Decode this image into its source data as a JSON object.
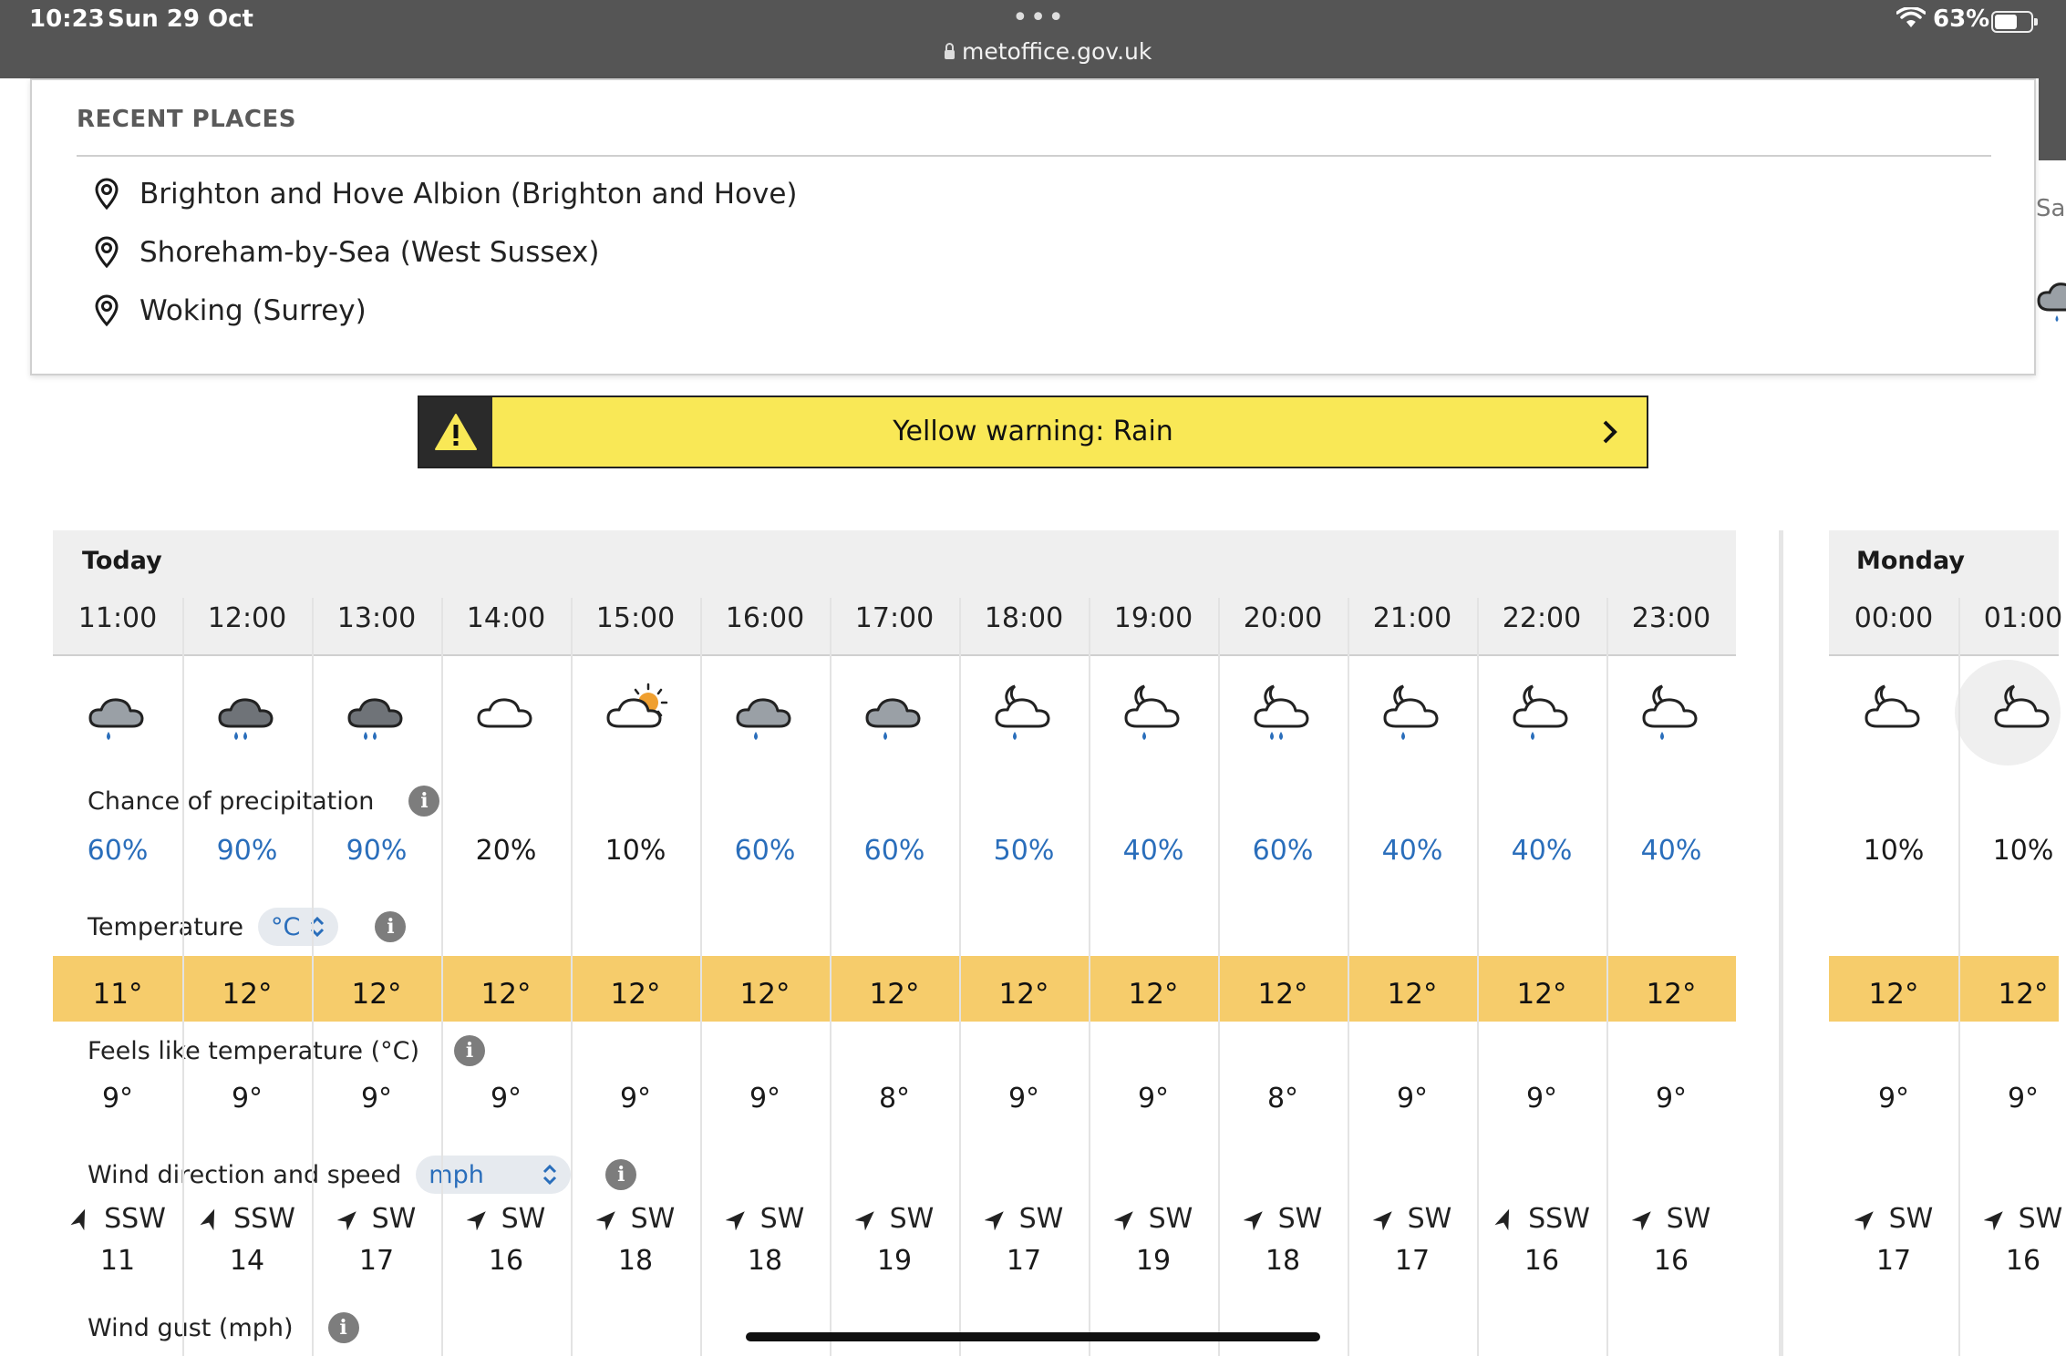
{
  "status_bar": {
    "time": "10:23",
    "date": "Sun 29 Oct",
    "dots": "•••",
    "url": "metoffice.gov.uk",
    "battery": "63%"
  },
  "background": {
    "partial_day": "Sa"
  },
  "recent_places": {
    "title": "RECENT PLACES",
    "items": [
      "Brighton and Hove Albion (Brighton and Hove)",
      "Shoreham-by-Sea (West Sussex)",
      "Woking (Surrey)"
    ]
  },
  "warning": {
    "text": "Yellow warning: Rain",
    "color": "#f9e856"
  },
  "forecast": {
    "days": [
      "Today",
      "Monday"
    ],
    "times": [
      "11:00",
      "12:00",
      "13:00",
      "14:00",
      "15:00",
      "16:00",
      "17:00",
      "18:00",
      "19:00",
      "20:00",
      "21:00",
      "22:00",
      "23:00",
      "00:00",
      "01:00"
    ],
    "weather_icons": [
      "cloud-light-rain-icon",
      "cloud-heavy-rain-icon",
      "cloud-heavy-rain-icon",
      "cloud-icon",
      "sun-cloud-icon",
      "cloud-light-rain-icon",
      "cloud-light-rain-icon",
      "night-cloud-light-rain-icon",
      "night-cloud-light-rain-icon",
      "night-cloud-heavy-rain-icon",
      "night-cloud-light-rain-icon",
      "night-cloud-light-rain-icon",
      "night-cloud-light-rain-icon",
      "night-cloud-icon",
      "night-cloud-icon"
    ],
    "labels": {
      "precip": "Chance of precipitation",
      "temp": "Temperature",
      "temp_unit": "°C",
      "feels": "Feels like temperature (°C)",
      "wind": "Wind direction and speed",
      "wind_unit": "mph",
      "gust": "Wind gust (mph)",
      "info": "i"
    },
    "precip": [
      "60%",
      "90%",
      "90%",
      "20%",
      "10%",
      "60%",
      "60%",
      "50%",
      "40%",
      "60%",
      "40%",
      "40%",
      "40%",
      "10%",
      "10%"
    ],
    "precip_highlight": [
      true,
      true,
      true,
      false,
      false,
      true,
      true,
      true,
      true,
      true,
      true,
      true,
      true,
      false,
      false
    ],
    "temp": [
      "11°",
      "12°",
      "12°",
      "12°",
      "12°",
      "12°",
      "12°",
      "12°",
      "12°",
      "12°",
      "12°",
      "12°",
      "12°",
      "12°",
      "12°"
    ],
    "feels": [
      "9°",
      "9°",
      "9°",
      "9°",
      "9°",
      "9°",
      "8°",
      "9°",
      "9°",
      "8°",
      "9°",
      "9°",
      "9°",
      "9°",
      "9°"
    ],
    "wind_dir": [
      "SSW",
      "SSW",
      "SW",
      "SW",
      "SW",
      "SW",
      "SW",
      "SW",
      "SW",
      "SW",
      "SW",
      "SSW",
      "SW",
      "SW",
      "SW"
    ],
    "wind_speed": [
      "11",
      "14",
      "17",
      "16",
      "18",
      "18",
      "19",
      "17",
      "19",
      "18",
      "17",
      "16",
      "16",
      "17",
      "16"
    ],
    "colors": {
      "blue_text": "#2a6ebb",
      "temp_band": "#f6cc6b",
      "header_bg": "#efefef"
    }
  }
}
